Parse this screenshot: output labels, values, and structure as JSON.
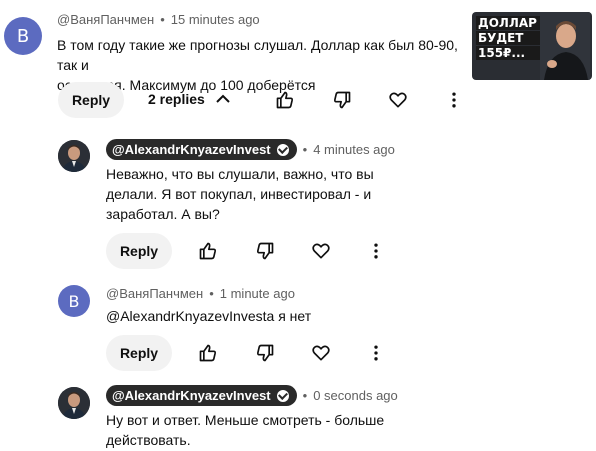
{
  "comment_main": {
    "avatar_letter": "B",
    "author": "@ВаняПанчмен",
    "time": "15 minutes ago",
    "text_line1": "В том году такие же прогнозы слушал. Доллар как был 80-90, так и",
    "text_line2": "останется. Максимум до 100 доберётся",
    "reply_label": "Reply",
    "replies_label": "2 replies"
  },
  "thumbnail": {
    "line1": "ДОЛЛАР",
    "line2": "БУДЕТ",
    "line3": "155₽..."
  },
  "reply1": {
    "author": "@AlexandrKnyazevInvest",
    "time": "4 minutes ago",
    "text_line1": "Неважно, что вы слушали, важно, что вы",
    "text_line2": "делали. Я вот покупал, инвестировал - и",
    "text_line3": "заработал. А вы?",
    "reply_label": "Reply"
  },
  "reply2": {
    "avatar_letter": "B",
    "author": "@ВаняПанчмен",
    "time": "1 minute ago",
    "text": "@AlexandrKnyazevInvesta я нет",
    "reply_label": "Reply"
  },
  "reply3": {
    "author": "@AlexandrKnyazevInvest",
    "time": "0 seconds ago",
    "text_line1": "Ну вот и ответ. Меньше смотреть - больше",
    "text_line2": "действовать."
  },
  "separator": "•",
  "icons": [
    "thumbs-up-icon",
    "thumbs-down-icon",
    "heart-icon",
    "more-vertical-icon",
    "chevron-up-icon",
    "verified-check-icon"
  ]
}
